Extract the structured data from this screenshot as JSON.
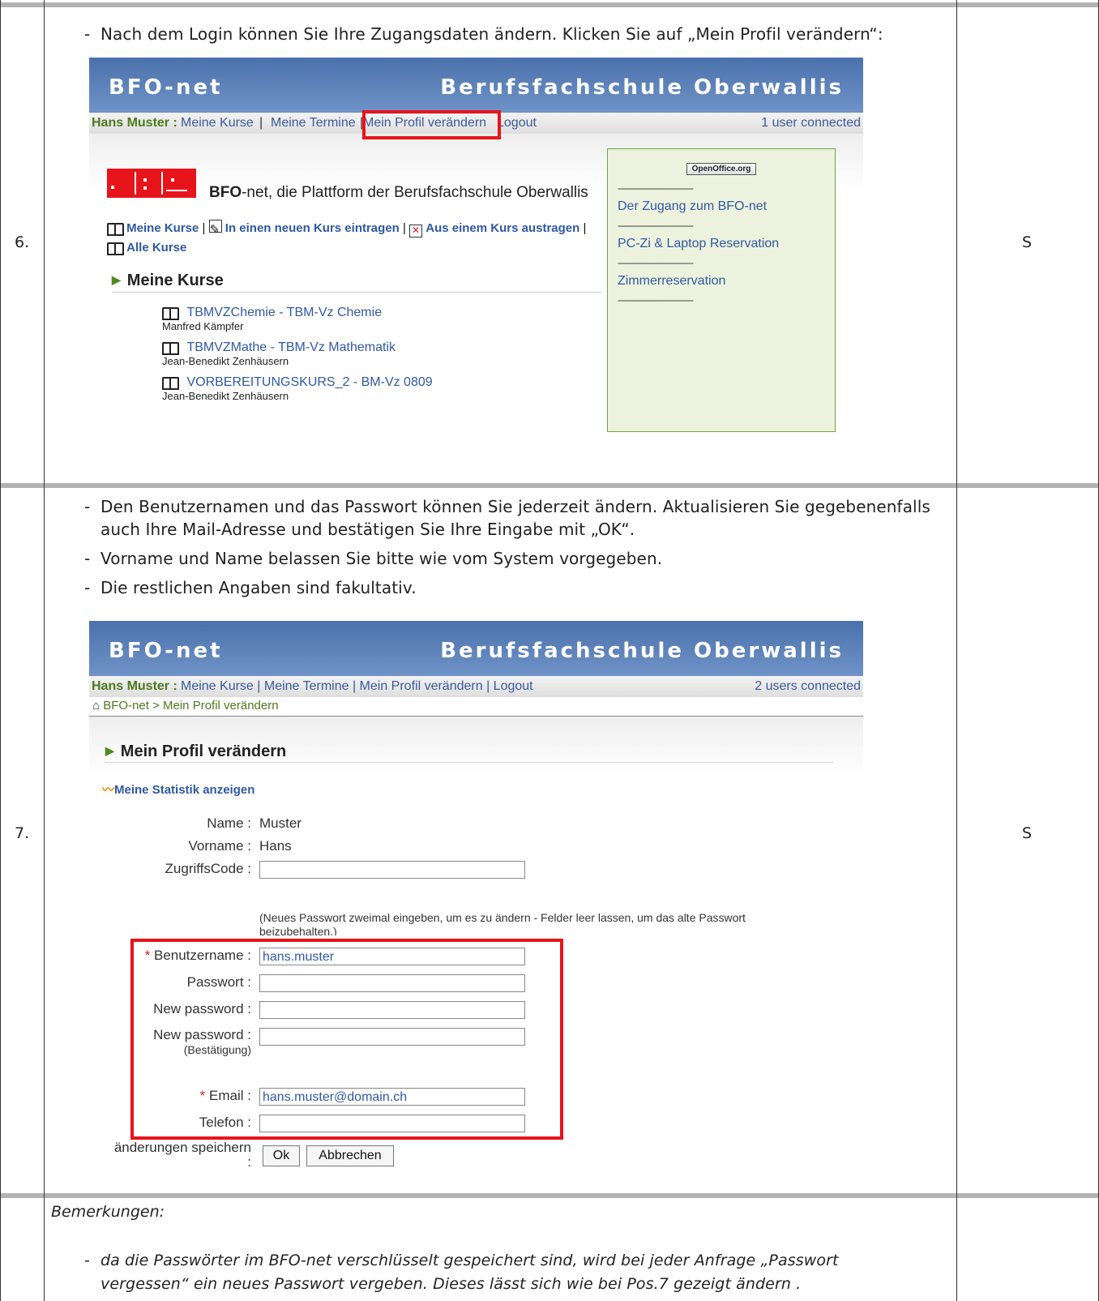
{
  "rows": [
    {
      "number": "6.",
      "code": "S",
      "instructions": [
        "Nach dem Login können Sie Ihre Zugangsdaten ändern. Klicken Sie auf „Mein Profil verändern“:"
      ],
      "screenshot": {
        "brand": "BFO-net",
        "school": "Berufsfachschule Oberwallis",
        "nav": {
          "user": "Hans Muster :",
          "meine_kurse": "Meine Kurse",
          "meine_termine": "Meine Termine",
          "mein_profil": "Mein Profil verändern",
          "logout": "Logout",
          "separator": "|",
          "connected": "1 user connected"
        },
        "logo_tagline_bold": "BFO",
        "logo_tagline_rest": "-net, die Plattform der Berufsfachschule Oberwallis",
        "actions": {
          "meine_kurse": "Meine Kurse",
          "neuer_kurs": "In einen neuen Kurs eintragen",
          "austragen": "Aus einem Kurs austragen",
          "alle_kurse": "Alle Kurse"
        },
        "section_title": "Meine Kurse",
        "courses": [
          {
            "title": "TBMVZChemie - TBM-Vz Chemie",
            "teacher": "Manfred Kämpfer"
          },
          {
            "title": "TBMVZMathe - TBM-Vz Mathematik",
            "teacher": "Jean-Benedikt Zenhäusern"
          },
          {
            "title": "VORBEREITUNGSKURS_2 - BM-Vz 0809",
            "teacher": "Jean-Benedikt Zenhäusern"
          }
        ],
        "sidebar": {
          "openoffice": "OpenOffice.org",
          "separator": "-------------------------------",
          "links": [
            "Der Zugang zum BFO-net",
            "PC-Zi & Laptop Reservation",
            "Zimmerreservation"
          ]
        }
      }
    },
    {
      "number": "7.",
      "code": "S",
      "instructions": [
        "Den Benutzernamen und das Passwort können Sie jederzeit ändern. Aktualisieren Sie gegebenenfalls auch Ihre Mail-Adresse und bestätigen Sie Ihre Eingabe mit „OK“.",
        "Vorname und Name belassen Sie bitte wie vom System vorgegeben.",
        "Die restlichen Angaben sind fakultativ."
      ],
      "screenshot": {
        "brand": "BFO-net",
        "school": "Berufsfachschule Oberwallis",
        "nav": {
          "user": "Hans Muster :",
          "links": "Meine Kurse | Meine Termine | Mein Profil verändern | Logout",
          "connected": "2 users connected"
        },
        "breadcrumb": "BFO-net > Mein Profil verändern",
        "section_title": "Mein Profil verändern",
        "stats_link": "Meine Statistik anzeigen",
        "form": {
          "name_label": "Name :",
          "name_value": "Muster",
          "vorname_label": "Vorname :",
          "vorname_value": "Hans",
          "zugriffscode_label": "ZugriffsCode :",
          "password_hint": "(Neues Passwort zweimal eingeben, um es zu ändern - Felder leer lassen, um das alte Passwort beizubehalten.)",
          "benutzername_label": "Benutzername :",
          "benutzername_value": "hans.muster",
          "passwort_label": "Passwort :",
          "new_password_label": "New password :",
          "new_password2_label": "New password :",
          "bestaetigung": "(Bestätigung)",
          "email_label": "Email :",
          "email_value": "hans.muster@domain.ch",
          "telefon_label": "Telefon :",
          "save_label": "änderungen speichern",
          "save_colon": ":",
          "required_mark": "*",
          "ok": "Ok",
          "cancel": "Abbrechen"
        }
      }
    }
  ],
  "remarks": {
    "title": "Bemerkungen:",
    "items": [
      "da die Passwörter im BFO-net verschlüsselt gespeichert sind, wird bei jeder Anfrage „Passwort vergessen“ ein neues Passwort vergeben. Dieses lässt sich wie bei Pos.7 gezeigt ändern ."
    ]
  },
  "colors": {
    "banner": "#4b71ac",
    "highlight": "#e8141b",
    "link": "#2f59a4",
    "user": "#4d7a1e",
    "sidebar_bg": "#edf2de"
  }
}
